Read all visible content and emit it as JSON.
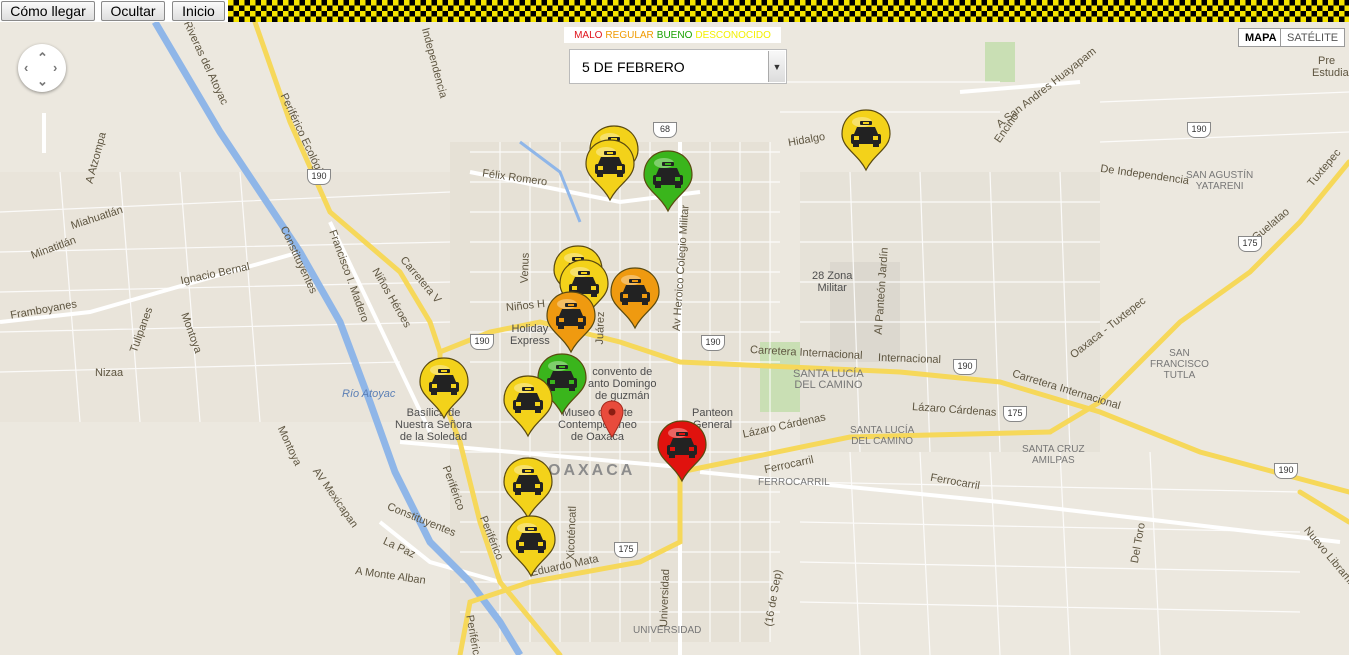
{
  "toolbar": {
    "directions_label": "Cómo llegar",
    "hide_label": "Ocultar",
    "home_label": "Inicio"
  },
  "legend": {
    "items": [
      {
        "label": "MALO",
        "color": "#e0121a"
      },
      {
        "label": "REGULAR",
        "color": "#f09a00"
      },
      {
        "label": "BUENO",
        "color": "#19a000"
      },
      {
        "label": "DESCONOCIDO",
        "color": "#f3f000"
      }
    ]
  },
  "date_select": {
    "selected": "5 DE FEBRERO"
  },
  "map_type": {
    "map_label": "MAPA",
    "satellite_label": "SATÉLITE",
    "active": "MAPA"
  },
  "map_labels": {
    "city": "OAXACA",
    "santa_lucia_1": "SANTA LUCÍA",
    "santa_lucia_2": "DEL CAMINO",
    "santa_lucia_small_1": "SANTA LUCÍA",
    "santa_lucia_small_2": "DEL CAMINO",
    "san_agustin_1": "SAN AGUSTÍN",
    "san_agustin_2": "YATARENI",
    "san_francisco_1": "SAN",
    "san_francisco_2": "FRANCISCO",
    "san_francisco_3": "TUTLA",
    "santa_cruz_1": "SANTA CRUZ",
    "santa_cruz_2": "AMILPAS",
    "ferrocarril_district": "FERROCARRIL",
    "universidad_district": "UNIVERSIDAD",
    "zona_militar_1": "28 Zona",
    "zona_militar_2": "Militar",
    "panteon_1": "Panteon",
    "panteon_2": "General",
    "basilica_1": "Basílica de",
    "basilica_2": "Nuestra Señora",
    "basilica_3": "de la Soledad",
    "museo_1": "Museo de Arte",
    "museo_2": "Contemporáneo",
    "museo_3": "de Oaxaca",
    "convento_1": "convento de",
    "convento_2": "anto Domingo",
    "convento_3": "de guzmán",
    "holiday_1": "Holiday",
    "holiday_2": "Express",
    "rio_atoyac": "Río Atoyac",
    "carretera_internacional_1": "Carretera Internacional",
    "carretera_internacional_2": "Internacional",
    "carretera_internacional_3": "Carretera Internacional",
    "lazaro_1": "Lázaro Cárdenas",
    "lazaro_2": "Lázaro Cárdenas",
    "ferrocarril_1": "Ferrocarril",
    "ferrocarril_2": "Ferrocarril",
    "felix_romero": "Félix Romero",
    "ignacio_bernal": "Ignacio Bernal",
    "framboyanes": "Framboyanes",
    "periferico_ecologico": "Periférico Ecológico",
    "periferico_1": "Periférico",
    "periferico_2": "Periférico",
    "periferico_3": "Periférico",
    "ninos_heroes_1": "Niños Héroes",
    "ninos_heroes_2": "Niños H",
    "constituyentes_1": "Constituyentes",
    "constituyentes_2": "Constituyentes",
    "carretera_v": "Carretera V",
    "av_mexicapan": "AV Mexicapan",
    "montoya_1": "Montoya",
    "montoya_2": "Montoya",
    "a_monte_alban": "A Monte Alban",
    "la_paz": "La Paz",
    "eduardo_mata": "Eduardo Mata",
    "universidad_road": "Universidad",
    "xicotencatl": "Xicoténcatl",
    "juarez": "Juárez",
    "venus": "Venus",
    "av_heroico": "Av Heroico Colegio Militar",
    "al_panteon": "Al Panteón Jardín",
    "a_san_andres": "A San Andres Huayapam",
    "a_guelatao": "A Guelatao",
    "tuxtepec": "Tuxtepec",
    "oaxaca_tuxtepec": "Oaxaca - Tuxtepec",
    "de_independencia": "De Independencia",
    "hidalgo": "Hidalgo",
    "encino": "Encino",
    "independencia": "Independencia",
    "a_atzompa": "A Atzompa",
    "miahuatlan": "Miahuatlán",
    "minatitlan": "Minatitlán",
    "francisco_madero": "Francisco I. Madero",
    "tulipanes": "Tulipanes",
    "nizaa": "Nizaa",
    "riveras_atoyac": "Riveras del Atoyac",
    "del_toro": "Del Toro",
    "nuevo_libramiento": "Nuevo Libramie",
    "sep": "(16 de Sep)",
    "estudian": "Estudian",
    "pre": "Pre"
  },
  "shields": [
    "190",
    "68",
    "190",
    "190",
    "190",
    "175",
    "190",
    "175",
    "175",
    "190"
  ],
  "markers": [
    {
      "status": "DESCONOCIDO",
      "color": "#f3d21a"
    },
    {
      "status": "DESCONOCIDO",
      "color": "#f3d21a"
    },
    {
      "status": "BUENO",
      "color": "#3ab51c"
    },
    {
      "status": "DESCONOCIDO",
      "color": "#f3d21a"
    },
    {
      "status": "DESCONOCIDO",
      "color": "#f3d21a"
    },
    {
      "status": "DESCONOCIDO",
      "color": "#f3d21a"
    },
    {
      "status": "REGULAR",
      "color": "#ef9a10"
    },
    {
      "status": "REGULAR",
      "color": "#ef9a10"
    },
    {
      "status": "DESCONOCIDO",
      "color": "#f3d21a"
    },
    {
      "status": "BUENO",
      "color": "#3ab51c"
    },
    {
      "status": "DESCONOCIDO",
      "color": "#f3d21a"
    },
    {
      "status": "MALO",
      "color": "#e0120e"
    },
    {
      "status": "DESCONOCIDO",
      "color": "#f3d21a"
    },
    {
      "status": "DESCONOCIDO",
      "color": "#f3d21a"
    }
  ],
  "colors": {
    "map_bg": "#ece8df",
    "highway": "#f6d85a",
    "river": "#8fb6e8",
    "pin": "#e84b3c"
  }
}
